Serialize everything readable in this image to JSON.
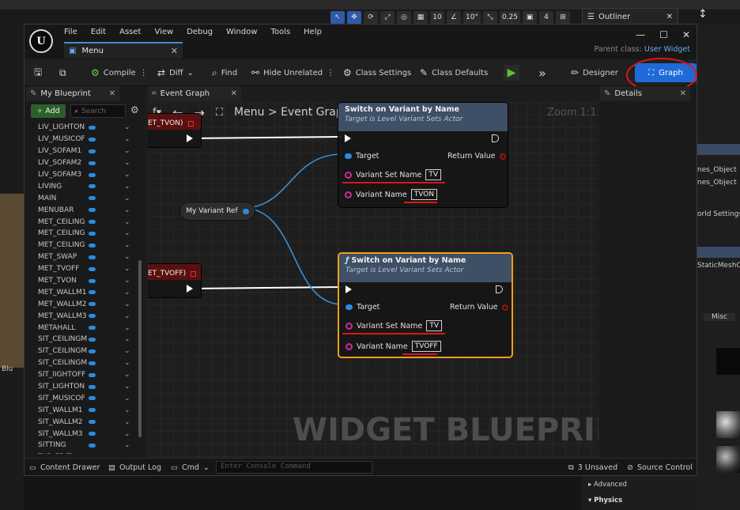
{
  "background": {
    "viewport_toolbar": [
      "↖",
      "✥",
      "⟳",
      "⤢",
      "◎",
      "▦",
      "10",
      "∠",
      "10°",
      "⤡",
      "0.25",
      "▣",
      "4",
      "⊞"
    ],
    "outliner_label": "Outliner",
    "right_panel_rows": [
      "nes_Object",
      "nes_Object",
      "orld Settings",
      "StaticMeshC",
      "Misc"
    ],
    "bottom_rows": [
      "Advanced",
      "Physics"
    ],
    "left_label": "Blu"
  },
  "window": {
    "logo": "U",
    "menus": [
      "File",
      "Edit",
      "Asset",
      "View",
      "Debug",
      "Window",
      "Tools",
      "Help"
    ],
    "doc_tab": "Menu",
    "parent_class_label": "Parent class:",
    "parent_class_value": "User Widget"
  },
  "toolbar": {
    "compile": "Compile",
    "diff": "Diff",
    "find": "Find",
    "hide_unrelated": "Hide Unrelated",
    "class_settings": "Class Settings",
    "class_defaults": "Class Defaults",
    "designer": "Designer",
    "graph": "Graph"
  },
  "left_panel": {
    "tab": "My Blueprint",
    "add": "Add",
    "search_placeholder": "Search",
    "variables": [
      "LIV_LIGHTON",
      "LIV_MUSICOF",
      "LIV_SOFAM1",
      "LIV_SOFAM2",
      "LIV_SOFAM3",
      "LIVING",
      "MAIN",
      "MENUBAR",
      "MET_CEILING",
      "MET_CEILING",
      "MET_CEILING",
      "MET_SWAP",
      "MET_TVOFF",
      "MET_TVON",
      "MET_WALLM1",
      "MET_WALLM2",
      "MET_WALLM3",
      "METAHALL",
      "SIT_CEILINGM",
      "SIT_CEILINGM",
      "SIT_CEILINGM",
      "SIT_lIGHTOFF",
      "SIT_LIGHTON",
      "SIT_MUSICOF",
      "SIT_WALLM1",
      "SIT_WALLM2",
      "SIT_WALLM3",
      "SITTING",
      "TAB_EDIT"
    ]
  },
  "graph": {
    "tab": "Event Graph",
    "breadcrumb_root": "Menu",
    "breadcrumb_sep": ">",
    "breadcrumb_leaf": "Event Graph",
    "zoom": "Zoom 1:1",
    "watermark": "WIDGET BLUEPRINT",
    "event_top": "ET_TVON)",
    "event_bottom": "ET_TVOFF)",
    "variant_ref": "My Variant Ref",
    "node1": {
      "title": "Switch on Variant by Name",
      "subtitle": "Target is Level Variant Sets Actor",
      "target": "Target",
      "return": "Return Value",
      "set_label": "Variant Set Name",
      "set_value": "TV",
      "name_label": "Variant Name",
      "name_value": "TVON"
    },
    "node2": {
      "title": "Switch on Variant by Name",
      "subtitle": "Target is Level Variant Sets Actor",
      "target": "Target",
      "return": "Return Value",
      "set_label": "Variant Set Name",
      "set_value": "TV",
      "name_label": "Variant Name",
      "name_value": "TVOFF"
    }
  },
  "details": {
    "tab": "Details"
  },
  "status": {
    "content_drawer": "Content Drawer",
    "output_log": "Output Log",
    "cmd": "Cmd",
    "console_placeholder": "Enter Console Command",
    "unsaved": "3 Unsaved",
    "source_control": "Source Control"
  },
  "colors": {
    "accent": "#1f6ad8",
    "highlight_red": "#e01515",
    "selection": "#f0a018",
    "exec_wire": "#ffffff",
    "object_wire": "#3a8fd6"
  }
}
